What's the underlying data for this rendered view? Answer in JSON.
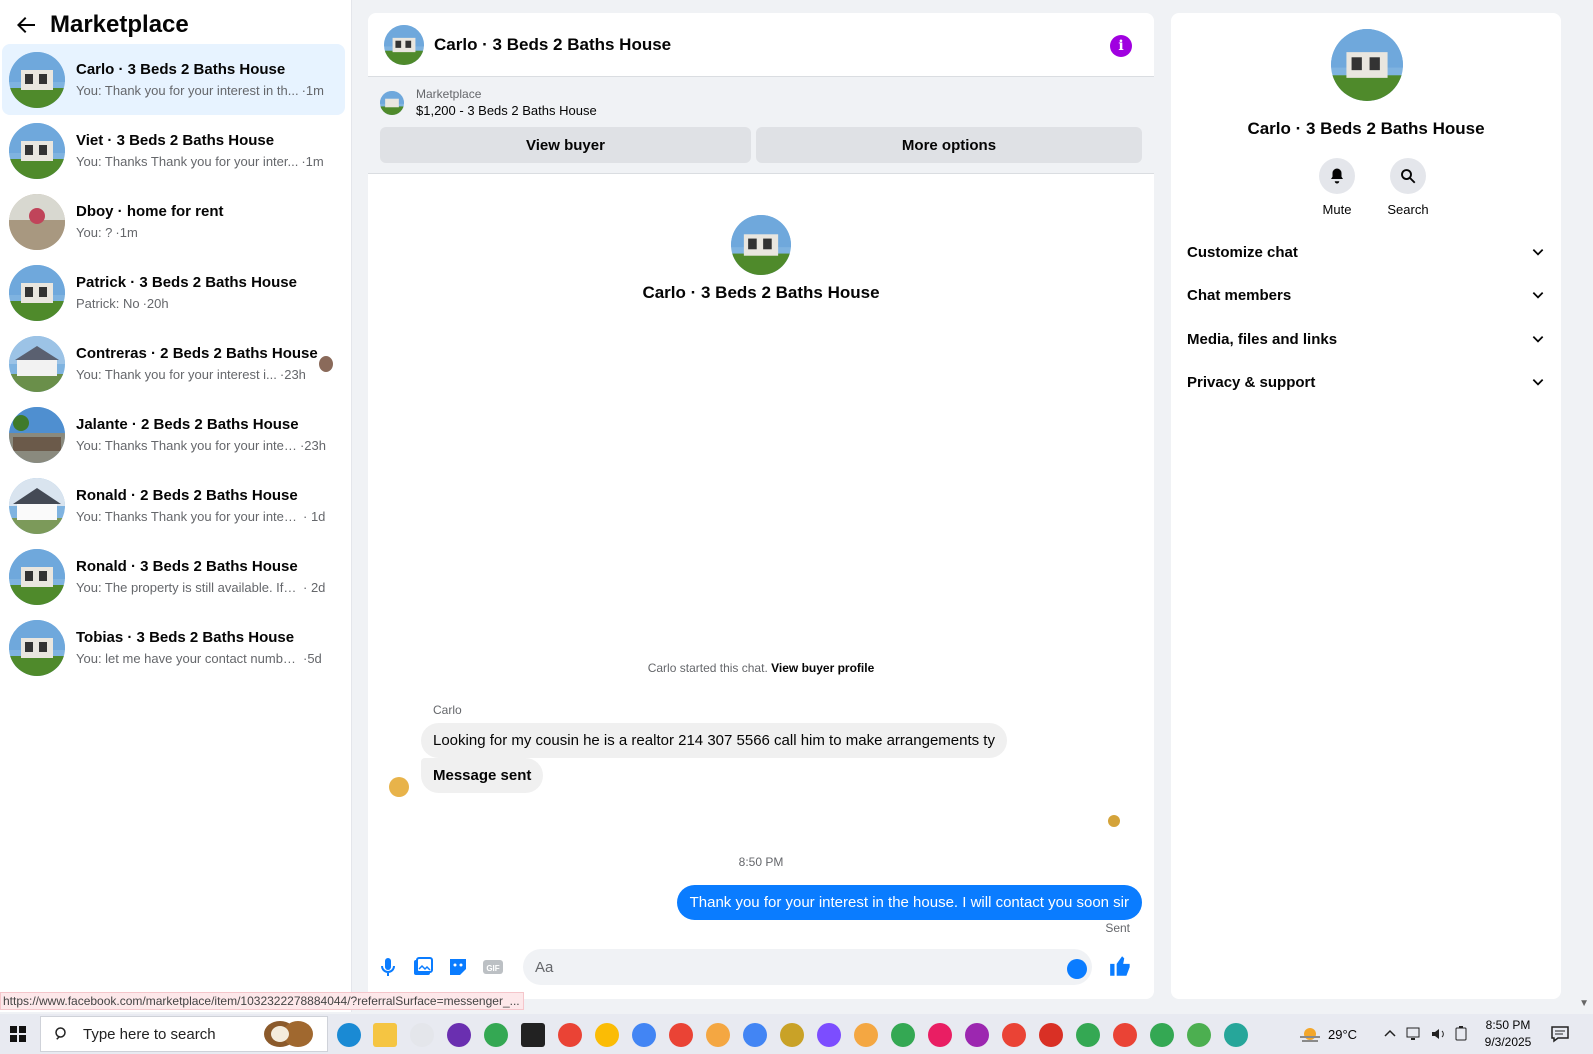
{
  "left": {
    "title": "Marketplace",
    "conversations": [
      {
        "name": "Carlo · 3 Beds 2 Baths House",
        "snippet": "You: Thank you for your interest in th...",
        "time": "·1m"
      },
      {
        "name": "Viet · 3 Beds 2 Baths House",
        "snippet": "You: Thanks Thank you for your inter...",
        "time": "·1m"
      },
      {
        "name": "Dboy · home for rent",
        "snippet": "You: ?",
        "time": "·1m"
      },
      {
        "name": "Patrick · 3 Beds 2 Baths House",
        "snippet": "Patrick: No",
        "time": "·20h"
      },
      {
        "name": "Contreras · 2 Beds 2 Baths House",
        "snippet": "You: Thank you for your interest i...",
        "time": "·23h"
      },
      {
        "name": "Jalante · 2 Beds 2 Baths House",
        "snippet": "You: Thanks Thank you for your inter...",
        "time": "·23h"
      },
      {
        "name": "Ronald · 2 Beds 2 Baths House",
        "snippet": "You: Thanks Thank you for your intere...",
        "time": "· 1d"
      },
      {
        "name": "Ronald · 3 Beds 2 Baths House",
        "snippet": "You: The property is still available. If y...",
        "time": "· 2d"
      },
      {
        "name": "Tobias · 3 Beds 2 Baths House",
        "snippet": "You: let me have your contact number...",
        "time": "·5d"
      }
    ]
  },
  "chat": {
    "title": "Carlo · 3 Beds 2 Baths House",
    "listing_label": "Marketplace",
    "listing_title": "$1,200 - 3 Beds 2 Baths House",
    "view_buyer": "View buyer",
    "more_options": "More options",
    "intro_name": "Carlo · 3 Beds 2 Baths House",
    "started_text": "Carlo started this chat.",
    "started_link": "View buyer profile",
    "sender": "Carlo",
    "incoming_1": "Looking for my cousin he is a realtor 214 307 5566 call him to make arrangements ty",
    "incoming_2": "Message sent",
    "timestamp": "8:50 PM",
    "outgoing": "Thank you for your interest in the house. I will contact you soon sir",
    "sent_label": "Sent",
    "input_placeholder": "Aa"
  },
  "right": {
    "name": "Carlo · 3 Beds 2 Baths House",
    "mute": "Mute",
    "search": "Search",
    "sections": [
      "Customize chat",
      "Chat members",
      "Media, files and links",
      "Privacy & support"
    ]
  },
  "status_url": "https://www.facebook.com/marketplace/item/1032322278884044/?referralSurface=messenger_...",
  "taskbar": {
    "search_text": "Type here to search",
    "temperature": "29°C",
    "time": "8:50 PM",
    "date": "9/3/2025"
  },
  "colors": {
    "accent": "#0a7cff",
    "active_bg": "#e7f3ff",
    "info": "#a000e0"
  }
}
